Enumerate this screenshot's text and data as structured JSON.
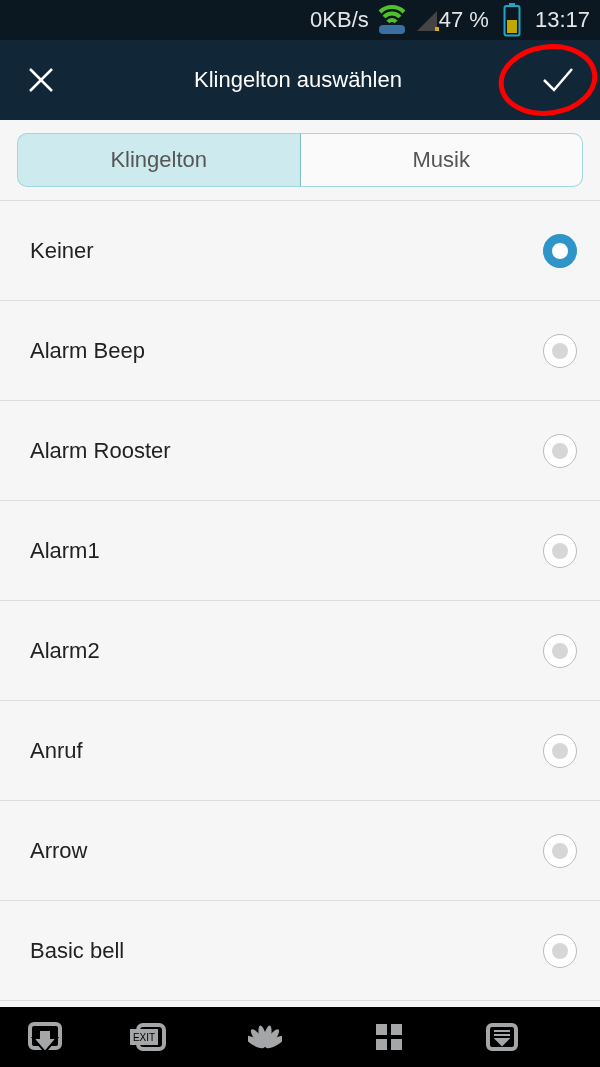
{
  "status_bar": {
    "speed": "0KB/s",
    "signal": "47 %",
    "time": "13:17"
  },
  "toolbar": {
    "title": "Klingelton auswählen",
    "confirm_marked": true
  },
  "tabs": [
    {
      "label": "Klingelton",
      "selected": true
    },
    {
      "label": "Musik",
      "selected": false
    }
  ],
  "ringtones": [
    {
      "name": "Keiner",
      "selected": true
    },
    {
      "name": "Alarm Beep",
      "selected": false
    },
    {
      "name": "Alarm Rooster",
      "selected": false
    },
    {
      "name": "Alarm1",
      "selected": false
    },
    {
      "name": "Alarm2",
      "selected": false
    },
    {
      "name": "Anruf",
      "selected": false
    },
    {
      "name": "Arrow",
      "selected": false
    },
    {
      "name": "Basic bell",
      "selected": false
    }
  ],
  "nav_keys": [
    {
      "kind": "download"
    },
    {
      "kind": "exit",
      "label": "EXIT"
    },
    {
      "kind": "petals"
    },
    {
      "kind": "grid"
    },
    {
      "kind": "tray"
    }
  ]
}
